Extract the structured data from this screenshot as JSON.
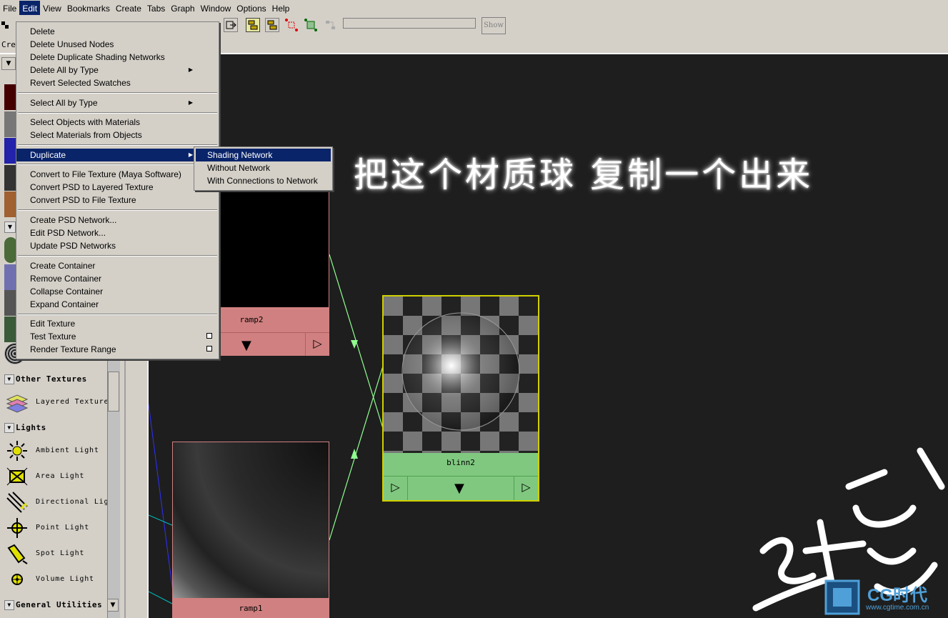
{
  "menubar": [
    "File",
    "Edit",
    "View",
    "Bookmarks",
    "Create",
    "Tabs",
    "Graph",
    "Window",
    "Options",
    "Help"
  ],
  "toolbar": {
    "show_label": "Show",
    "panel_label": "Cre"
  },
  "edit_menu": [
    {
      "label": "Delete"
    },
    {
      "label": "Delete Unused Nodes"
    },
    {
      "label": "Delete Duplicate Shading Networks"
    },
    {
      "label": "Delete All by Type",
      "submenu": true
    },
    {
      "label": "Revert Selected Swatches"
    },
    {
      "label": "Select All by Type",
      "submenu": true
    },
    {
      "label": "Select Objects with Materials"
    },
    {
      "label": "Select Materials from Objects"
    },
    {
      "label": "Duplicate",
      "submenu": true,
      "highlighted": true
    },
    {
      "label": "Convert to File Texture (Maya Software)"
    },
    {
      "label": "Convert PSD to Layered Texture"
    },
    {
      "label": "Convert PSD to File Texture"
    },
    {
      "label": "Create PSD Network..."
    },
    {
      "label": "Edit PSD Network..."
    },
    {
      "label": "Update PSD Networks"
    },
    {
      "label": "Create Container"
    },
    {
      "label": "Remove Container"
    },
    {
      "label": "Collapse Container"
    },
    {
      "label": "Expand Container"
    },
    {
      "label": "Edit Texture"
    },
    {
      "label": "Test Texture",
      "option": true
    },
    {
      "label": "Render Texture Range",
      "option": true
    }
  ],
  "duplicate_submenu": [
    {
      "label": "Shading Network",
      "highlighted": true
    },
    {
      "label": "Without Network"
    },
    {
      "label": "With Connections to Network"
    }
  ],
  "left_panel": {
    "sections": [
      {
        "title": "Other Textures",
        "items": [
          {
            "label": "Layered Texture",
            "icon": "layered-texture-icon"
          }
        ]
      },
      {
        "title": "Lights",
        "items": [
          {
            "label": "Ambient Light",
            "icon": "ambient-light-icon"
          },
          {
            "label": "Area Light",
            "icon": "area-light-icon"
          },
          {
            "label": "Directional Ligh",
            "icon": "directional-light-icon"
          },
          {
            "label": "Point Light",
            "icon": "point-light-icon"
          },
          {
            "label": "Spot Light",
            "icon": "spot-light-icon"
          },
          {
            "label": "Volume Light",
            "icon": "volume-light-icon"
          }
        ]
      },
      {
        "title": "General Utilities",
        "items": []
      }
    ]
  },
  "graph": {
    "nodes": [
      {
        "name": "ramp2"
      },
      {
        "name": "blinn2"
      },
      {
        "name": "ramp1"
      }
    ]
  },
  "annotation": "把这个材质球 复制一个出来",
  "watermark_sign": "张蒽",
  "logo": {
    "brand": "CG时代",
    "url": "www.cgtime.com.cn"
  },
  "colors": {
    "menu_highlight": "#0a246a",
    "node_pink": "#d08080",
    "node_green": "#80c880",
    "connection": "#90ff90",
    "selection_yellow": "#e0e000"
  }
}
